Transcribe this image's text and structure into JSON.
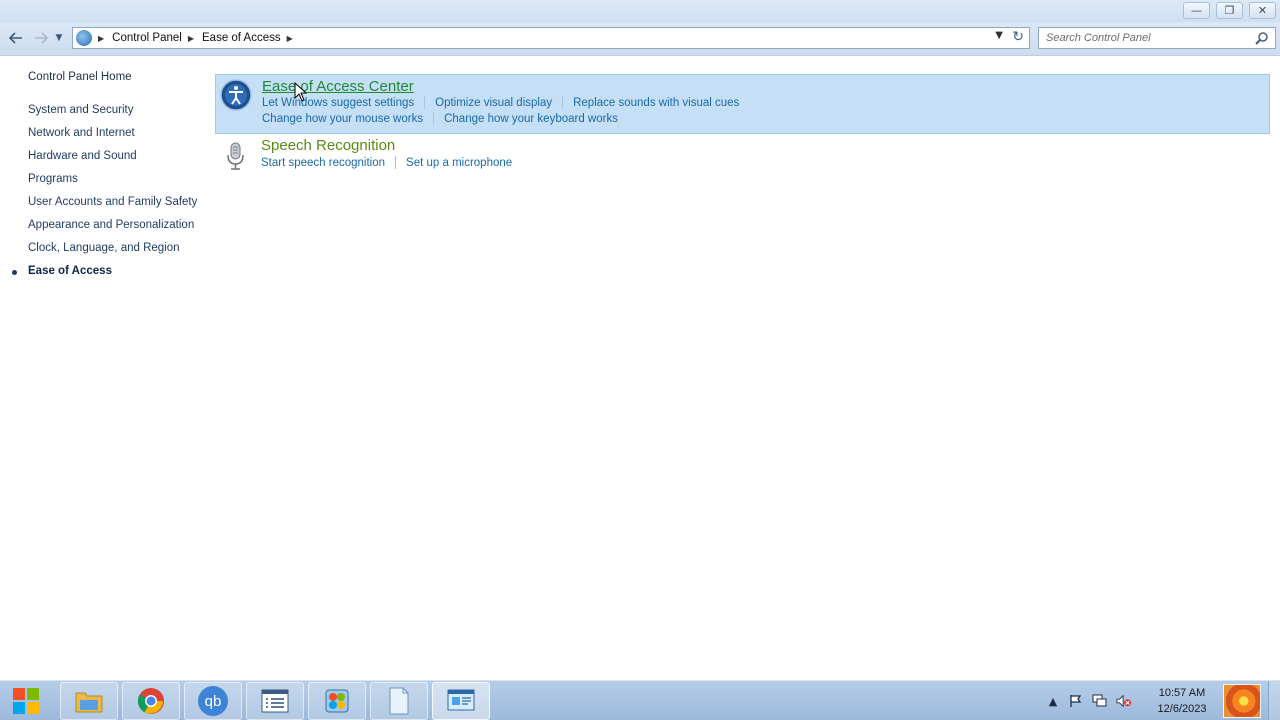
{
  "window": {
    "minimize_symbol": "—",
    "maximize_symbol": "❐",
    "close_symbol": "✕"
  },
  "nav": {
    "back_icon": "arrow-left-icon",
    "forward_icon": "arrow-right-icon",
    "breadcrumbs": [
      "Control Panel",
      "Ease of Access"
    ],
    "search_placeholder": "Search Control Panel"
  },
  "sidebar": {
    "home": "Control Panel Home",
    "items": [
      {
        "label": "System and Security",
        "active": false
      },
      {
        "label": "Network and Internet",
        "active": false
      },
      {
        "label": "Hardware and Sound",
        "active": false
      },
      {
        "label": "Programs",
        "active": false
      },
      {
        "label": "User Accounts and Family Safety",
        "active": false
      },
      {
        "label": "Appearance and Personalization",
        "active": false
      },
      {
        "label": "Clock, Language, and Region",
        "active": false
      },
      {
        "label": "Ease of Access",
        "active": true
      }
    ]
  },
  "categories": [
    {
      "title": "Ease of Access Center",
      "icon": "ease-of-access-icon",
      "links_row1": [
        "Let Windows suggest settings",
        "Optimize visual display",
        "Replace sounds with visual cues"
      ],
      "links_row2": [
        "Change how your mouse works",
        "Change how your keyboard works"
      ]
    },
    {
      "title": "Speech Recognition",
      "icon": "microphone-icon",
      "links_row1": [
        "Start speech recognition",
        "Set up a microphone"
      ]
    }
  ],
  "taskbar": {
    "apps": [
      "start-button",
      "file-explorer",
      "chrome",
      "qbittorrent",
      "task-list",
      "paint",
      "notepad",
      "control-panel"
    ],
    "qb_label": "qb",
    "time": "10:57 AM",
    "date": "12/6/2023"
  },
  "colors": {
    "highlight_bg": "#c4dff6",
    "category_title_hover": "#1d8a33",
    "category_title": "#5a8a16",
    "link": "#1a6aa8"
  }
}
